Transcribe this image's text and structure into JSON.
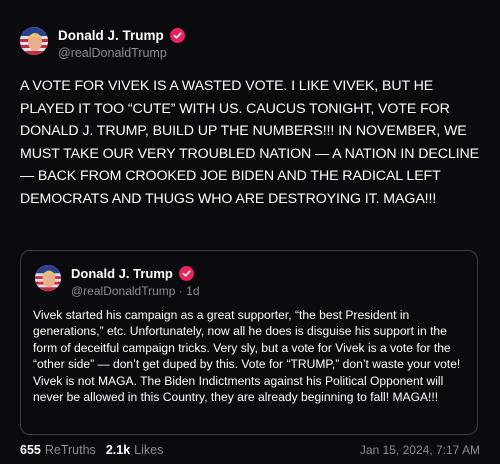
{
  "post": {
    "author_name": "Donald J. Trump",
    "handle": "@realDonaldTrump",
    "text": "A VOTE FOR VIVEK IS A WASTED VOTE. I LIKE VIVEK, BUT HE PLAYED IT TOO “CUTE” WITH US. CAUCUS TONIGHT, VOTE FOR DONALD J. TRUMP, BUILD UP THE NUMBERS!!! IN NOVEMBER, WE MUST TAKE OUR VERY TROUBLED NATION — A NATION IN DECLINE  — BACK FROM CROOKED JOE BIDEN AND THE RADICAL LEFT DEMOCRATS AND THUGS WHO ARE DESTROYING IT. MAGA!!!"
  },
  "quoted": {
    "author_name": "Donald J. Trump",
    "handle": "@realDonaldTrump",
    "age": "1d",
    "text": "Vivek started his campaign as a great supporter, “the best President in generations,” etc. Unfortunately, now all he does is disguise his support in the form of deceitful campaign tricks. Very sly, but a vote for Vivek is a vote for the “other side” — don’t get duped by this. Vote for “TRUMP,” don’t waste your vote! Vivek is not MAGA. The Biden Indictments against his Political Opponent will never be allowed in this Country, they are already beginning to fall! MAGA!!!"
  },
  "footer": {
    "retruths_count": "655",
    "retruths_label": "ReTruths",
    "likes_count": "2.1k",
    "likes_label": "Likes",
    "timestamp": "Jan 15, 2024, 7:17 AM"
  },
  "colors": {
    "background": "#0b0b0f",
    "verified_badge": "#e8235e",
    "muted_text": "#8a8d96"
  }
}
